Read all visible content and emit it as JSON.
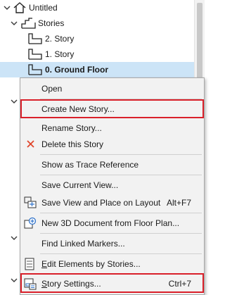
{
  "tree": {
    "root": {
      "label": "Untitled",
      "icon": "house-icon"
    },
    "stories_folder": {
      "label": "Stories",
      "icon": "stories-folder-icon"
    },
    "stories": [
      {
        "label": "2. Story",
        "icon": "story-icon"
      },
      {
        "label": "1. Story",
        "icon": "story-icon"
      },
      {
        "label": "0. Ground Floor",
        "icon": "story-icon",
        "selected": true
      }
    ]
  },
  "menu": {
    "open": "Open",
    "create_new_story": "Create New Story...",
    "rename_story": "Rename Story...",
    "delete_story": "Delete this Story",
    "show_trace": "Show as Trace Reference",
    "save_current_view": "Save Current View...",
    "save_view_place_layout": "Save View and Place on Layout",
    "save_view_place_layout_shortcut": "Alt+F7",
    "new_3d_document": "New 3D Document from Floor Plan...",
    "find_linked_markers": "Find Linked Markers...",
    "edit_elements_by_stories": "Edit Elements by Stories...",
    "story_settings": "Story Settings...",
    "story_settings_shortcut": "Ctrl+7"
  },
  "colors": {
    "selection": "#cce4f7",
    "highlight": "#d9202a",
    "delete_icon": "#e0452b",
    "menu_bg": "#f2f2f2"
  }
}
